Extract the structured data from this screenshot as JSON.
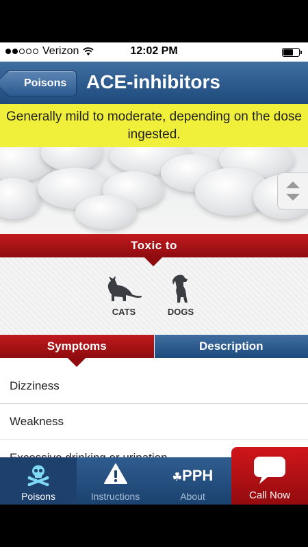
{
  "status_bar": {
    "carrier": "Verizon",
    "time": "12:02 PM",
    "signal_bars_filled": 2,
    "signal_bars_total": 5,
    "icons": [
      "signal-icon",
      "wifi-icon",
      "battery-icon"
    ]
  },
  "nav": {
    "back_label": "Poisons",
    "title": "ACE-inhibitors"
  },
  "severity_text": "Generally mild to moderate, depending on the dose ingested.",
  "toxic_section": {
    "header": "Toxic to",
    "animals": [
      {
        "label": "CATS",
        "icon": "cat-icon"
      },
      {
        "label": "DOGS",
        "icon": "dog-icon"
      }
    ]
  },
  "tabs": [
    {
      "label": "Symptoms",
      "selected": true
    },
    {
      "label": "Description",
      "selected": false
    }
  ],
  "symptoms": [
    "Dizziness",
    "Weakness",
    "Excessive drinking or urination"
  ],
  "tab_bar": {
    "items": [
      {
        "label": "Poisons",
        "icon": "skull-crossbones-icon",
        "active": true
      },
      {
        "label": "Instructions",
        "icon": "warning-icon",
        "active": false
      },
      {
        "label": "About",
        "icon": "pph-logo-icon",
        "logo_text": "PPH",
        "active": false
      }
    ],
    "call_label": "Call Now",
    "call_icon": "speech-bubble-icon"
  },
  "colors": {
    "nav_blue": "#2c5a8f",
    "banner_yellow": "#f0f03a",
    "header_red": "#b3161a"
  }
}
